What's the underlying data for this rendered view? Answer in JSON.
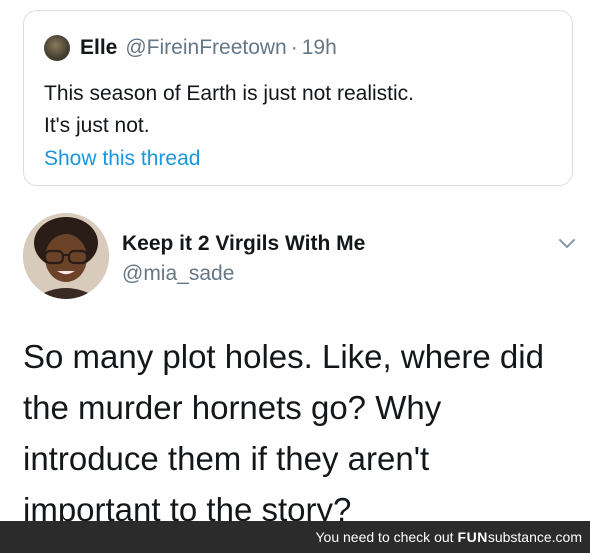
{
  "quoted_tweet": {
    "name": "Elle",
    "handle": "@FireinFreetown",
    "separator": "·",
    "time": "19h",
    "text_lines": [
      "This season of Earth is just not realistic.",
      "It's just not."
    ],
    "show_thread": "Show this thread"
  },
  "tweet": {
    "display_name": "Keep it 2 Virgils With Me",
    "handle": "@mia_sade",
    "text_lines": [
      "So many plot holes. Like, where did",
      "the murder hornets go? Why",
      "introduce them if they aren't",
      "important to the story?"
    ]
  },
  "footer": {
    "prefix": "You need to check out",
    "brand_bold": "FUN",
    "brand_rest": "substance.com"
  },
  "colors": {
    "text": "#14171a",
    "secondary": "#657786",
    "link": "#1b95e0",
    "border": "#d9dde1",
    "footer_bg": "#2b2b2b"
  },
  "icons": [
    "quoted-avatar",
    "author-avatar",
    "chevron-down-icon"
  ]
}
